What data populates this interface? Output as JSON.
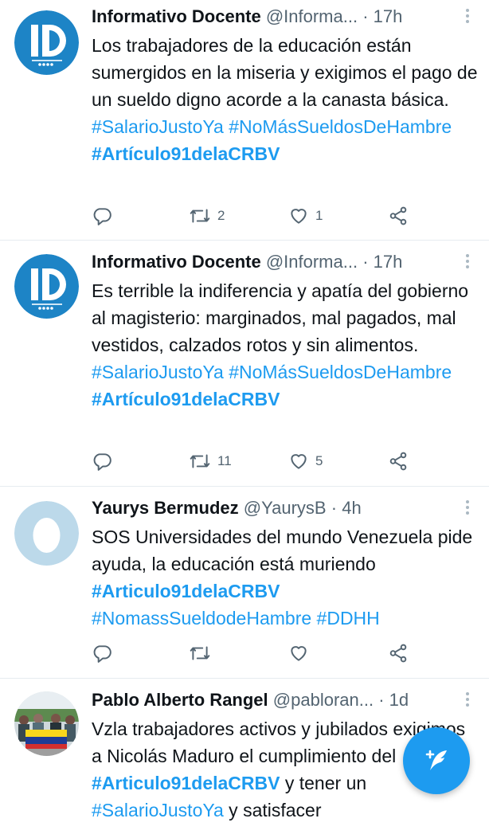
{
  "colors": {
    "accent": "#1d9bf0",
    "muted": "#536471",
    "text": "#0f1419",
    "divider": "#e6ecf0"
  },
  "tweets": [
    {
      "name": "Informativo Docente",
      "handle": "@Informa...",
      "time": "17h",
      "avatar": "informativo-docente-logo",
      "text": [
        {
          "t": "Los trabajadores de la educación están sumergidos en la miseria y exigimos el pago de un sueldo digno acorde a la canasta básica. "
        },
        {
          "t": "#SalarioJustoYa",
          "tag": true
        },
        {
          "t": " "
        },
        {
          "t": "#NoMásSueldosDeHambre",
          "tag": true
        },
        {
          "t": " "
        },
        {
          "t": "#Artículo91delaCRBV",
          "tag": true,
          "bold": true
        }
      ],
      "retweets": "2",
      "likes": "1"
    },
    {
      "name": "Informativo Docente",
      "handle": "@Informa...",
      "time": "17h",
      "avatar": "informativo-docente-logo",
      "text": [
        {
          "t": "Es terrible la indiferencia y apatía del gobierno al magisterio: marginados, mal pagados, mal vestidos, calzados rotos y sin alimentos. "
        },
        {
          "t": "#SalarioJustoYa",
          "tag": true
        },
        {
          "t": " "
        },
        {
          "t": "#NoMásSueldosDeHambre",
          "tag": true
        },
        {
          "t": " "
        },
        {
          "t": "#Artículo91delaCRBV",
          "tag": true,
          "bold": true
        }
      ],
      "retweets": "11",
      "likes": "5"
    },
    {
      "name": "Yaurys Bermudez",
      "handle": "@YaurysB",
      "time": "4h",
      "avatar": "default-egg-avatar",
      "text": [
        {
          "t": "SOS Universidades del mundo Venezuela pide ayuda, la educación está muriendo "
        },
        {
          "t": "#Articulo91delaCRBV",
          "tag": true,
          "bold": true
        },
        {
          "t": " "
        },
        {
          "t": "#NomassSueldodeHambre",
          "tag": true
        },
        {
          "t": " "
        },
        {
          "t": "#DDHH",
          "tag": true
        }
      ],
      "retweets": "",
      "likes": ""
    },
    {
      "name": "Pablo Alberto Rangel",
      "handle": "@pabloran...",
      "time": "1d",
      "avatar": "group-photo-with-flag",
      "text": [
        {
          "t": "Vzla trabajadores activos y jubilados exigimos a Nicolás Maduro el cumplimiento del "
        },
        {
          "t": "#Articulo91delaCRBV",
          "tag": true,
          "bold": true
        },
        {
          "t": " y tener un "
        },
        {
          "t": "#SalarioJustoYa",
          "tag": true
        },
        {
          "t": " y satisfacer"
        }
      ],
      "retweets": "",
      "likes": ""
    }
  ],
  "fab": {
    "icon": "compose-tweet-icon"
  }
}
